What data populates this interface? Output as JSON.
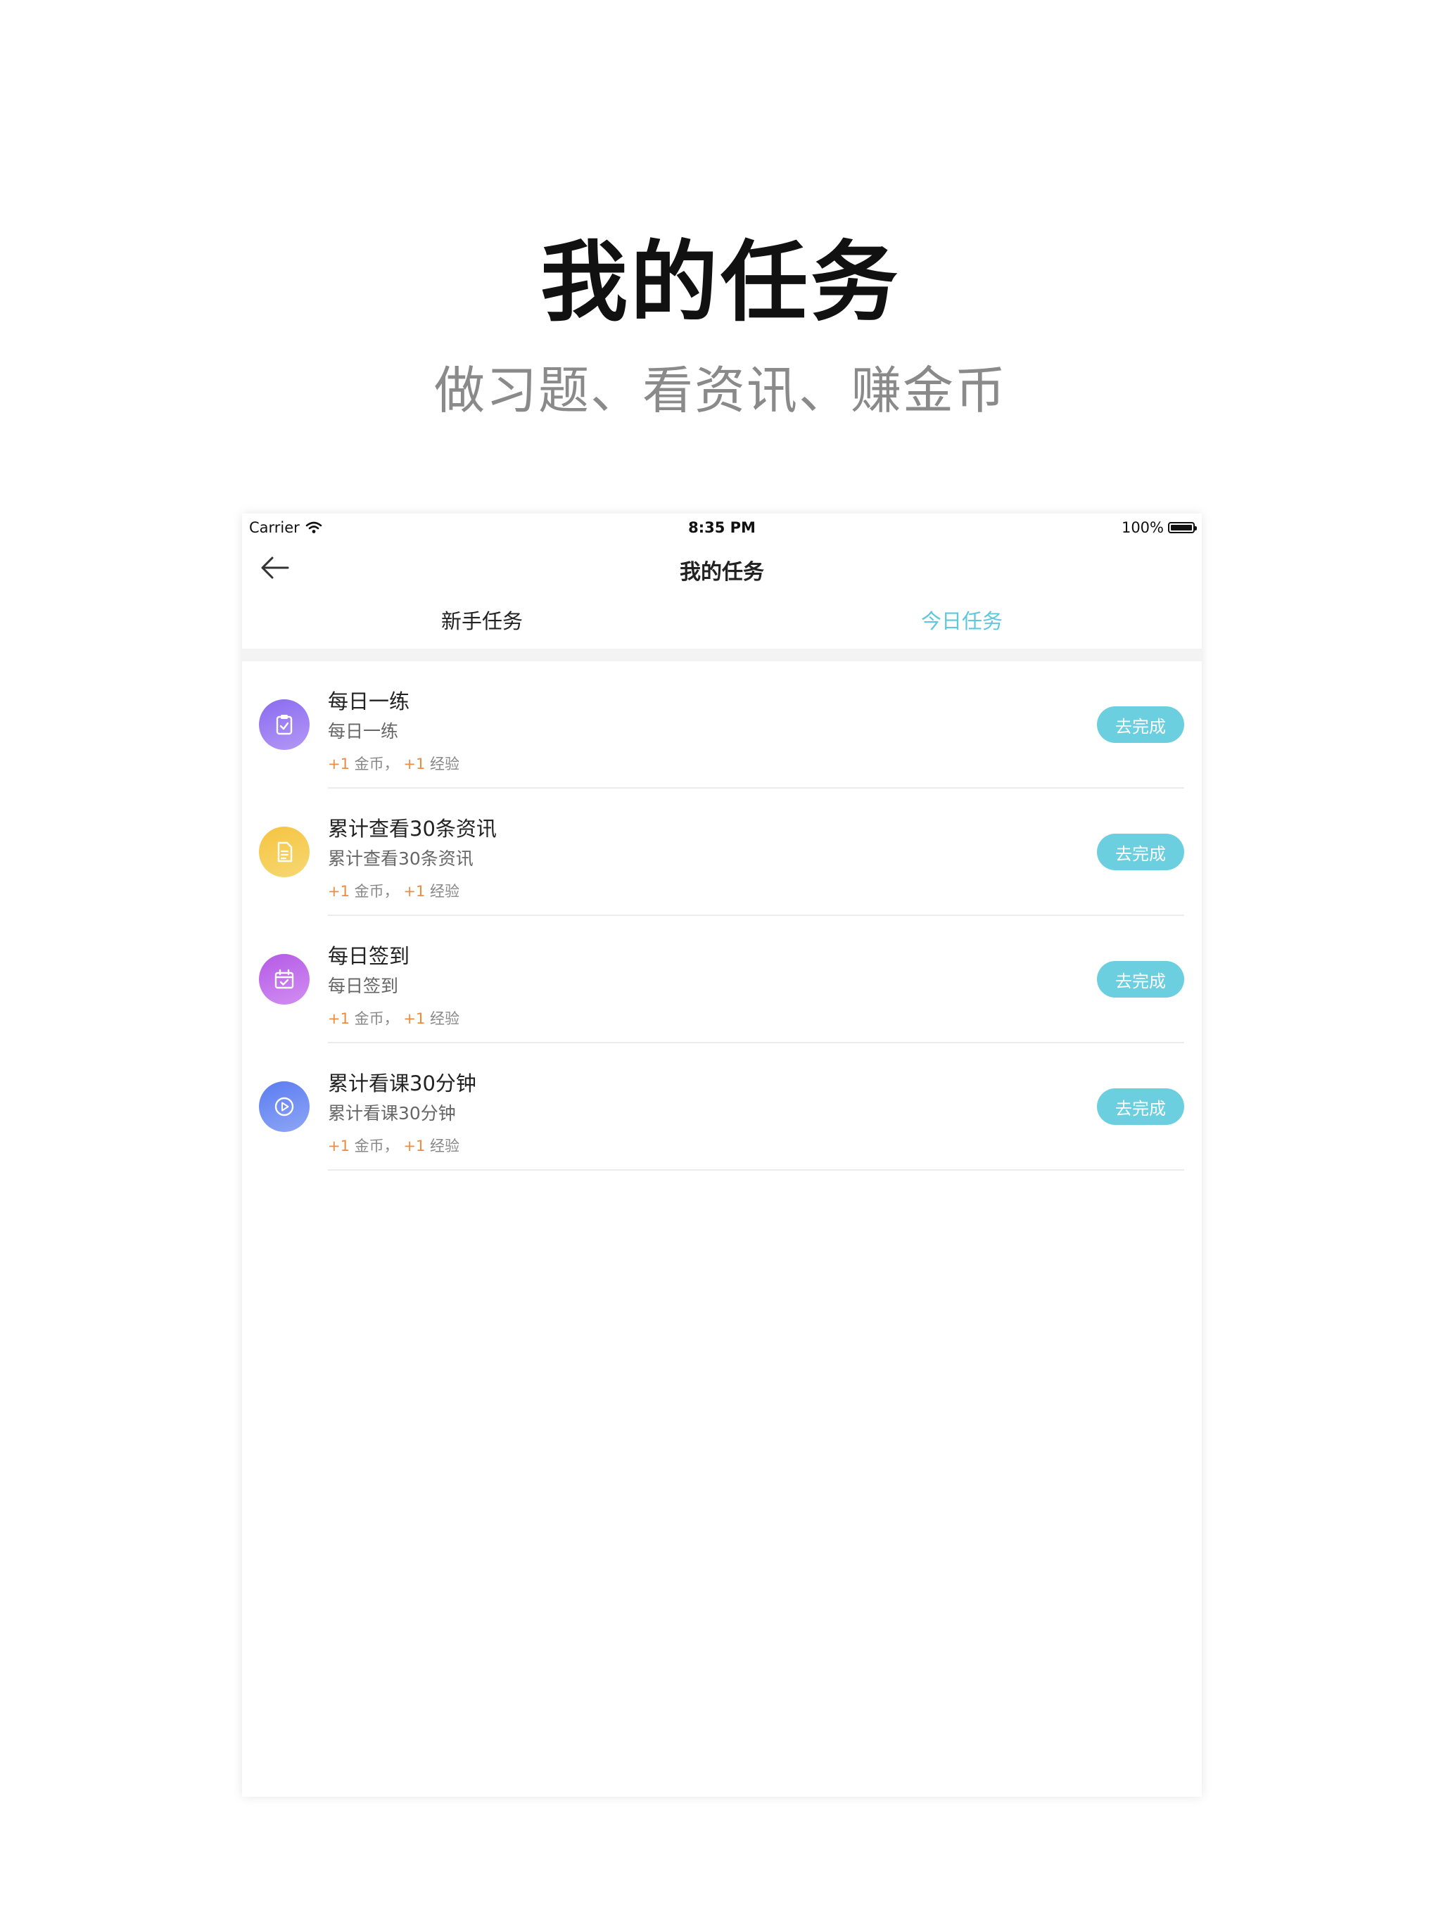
{
  "promo": {
    "title": "我的任务",
    "subtitle": "做习题、看资讯、赚金币"
  },
  "status_bar": {
    "carrier": "Carrier",
    "time": "8:35 PM",
    "battery": "100%"
  },
  "nav": {
    "title": "我的任务",
    "back_icon": "arrow-left-icon"
  },
  "tabs": [
    {
      "label": "新手任务",
      "active": false
    },
    {
      "label": "今日任务",
      "active": true
    }
  ],
  "colors": {
    "accent": "#5fc8dc",
    "button": "#6ccfe0",
    "reward": "#f08a3c"
  },
  "tasks": [
    {
      "title": "每日一练",
      "desc": "每日一练",
      "coin_num": "+1",
      "coin_label": "金币，",
      "exp_num": "+1",
      "exp_label": "经验",
      "button": "去完成",
      "icon": "clipboard-check-icon"
    },
    {
      "title": "累计查看30条资讯",
      "desc": "累计查看30条资讯",
      "coin_num": "+1",
      "coin_label": "金币，",
      "exp_num": "+1",
      "exp_label": "经验",
      "button": "去完成",
      "icon": "document-icon"
    },
    {
      "title": "每日签到",
      "desc": "每日签到",
      "coin_num": "+1",
      "coin_label": "金币，",
      "exp_num": "+1",
      "exp_label": "经验",
      "button": "去完成",
      "icon": "calendar-check-icon"
    },
    {
      "title": "累计看课30分钟",
      "desc": "累计看课30分钟",
      "coin_num": "+1",
      "coin_label": "金币，",
      "exp_num": "+1",
      "exp_label": "经验",
      "button": "去完成",
      "icon": "play-circle-icon"
    }
  ]
}
